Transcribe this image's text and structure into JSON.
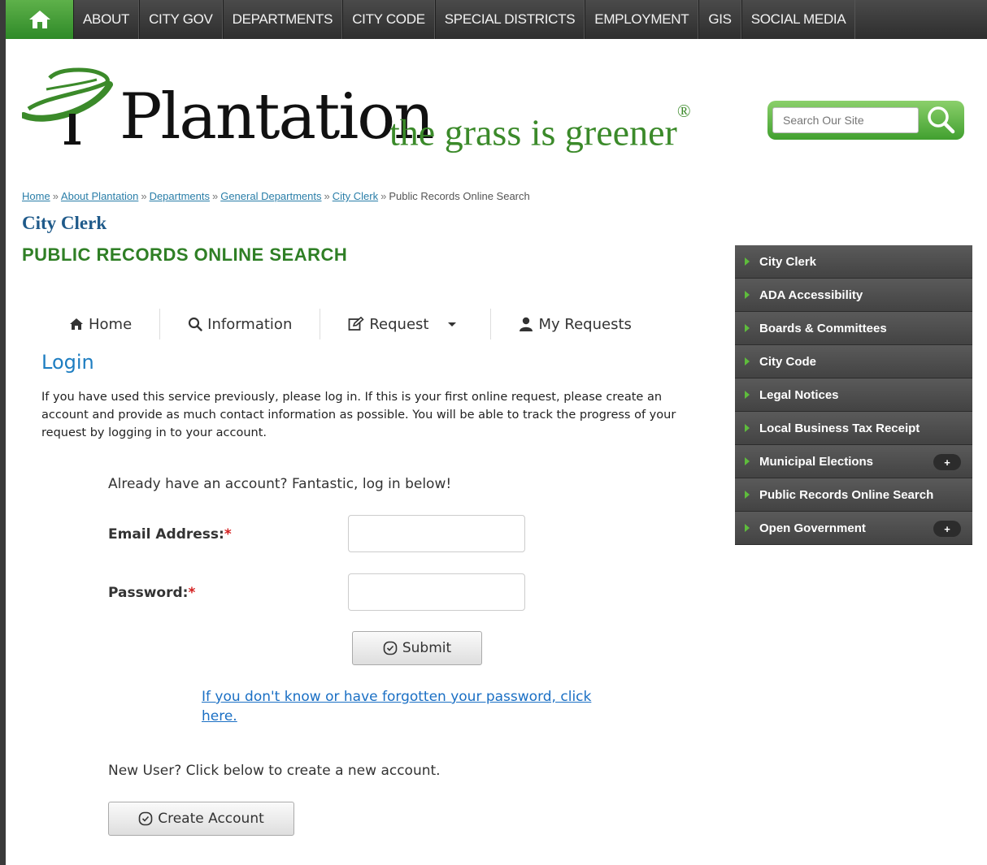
{
  "nav": {
    "items": [
      "ABOUT",
      "CITY GOV",
      "DEPARTMENTS",
      "CITY CODE",
      "SPECIAL DISTRICTS",
      "EMPLOYMENT",
      "GIS",
      "SOCIAL MEDIA"
    ]
  },
  "header": {
    "wordmark": "Plantation",
    "tagline": "the grass is greener",
    "tagline_mark": "®",
    "search_placeholder": "Search Our Site"
  },
  "breadcrumb": {
    "links": [
      "Home",
      "About Plantation",
      "Departments",
      "General Departments",
      "City Clerk"
    ],
    "current": "Public Records Online Search",
    "separator": "»"
  },
  "section_title": "City Clerk",
  "page_title": "PUBLIC RECORDS ONLINE SEARCH",
  "tabs": {
    "home": "Home",
    "information": "Information",
    "request": "Request",
    "my_requests": "My Requests"
  },
  "login": {
    "heading": "Login",
    "intro": "If you have used this service previously, please log in. If this is your first online request, please create an account and provide as much contact information as possible. You will be able to track the progress of your request by logging in to your account.",
    "already": "Already have an account? Fantastic, log in below!",
    "email_label": "Email Address:",
    "password_label": "Password:",
    "required_mark": "*",
    "submit": "Submit",
    "forgot": "If you don't know or have forgotten your password, click here.",
    "new_user": "New User? Click below to create a new account.",
    "create_account": "Create Account"
  },
  "sidebar": {
    "items": [
      {
        "label": "City Clerk",
        "expand": ""
      },
      {
        "label": "ADA Accessibility",
        "expand": ""
      },
      {
        "label": "Boards & Committees",
        "expand": ""
      },
      {
        "label": "City Code",
        "expand": ""
      },
      {
        "label": "Legal Notices",
        "expand": ""
      },
      {
        "label": "Local Business Tax Receipt",
        "expand": ""
      },
      {
        "label": "Municipal Elections",
        "expand": "+"
      },
      {
        "label": "Public Records Online Search",
        "expand": ""
      },
      {
        "label": "Open Government",
        "expand": "+"
      }
    ]
  },
  "colors": {
    "brand_green": "#3b8a2a",
    "title_green": "#2f7f25",
    "link_blue": "#1a6fc4",
    "sidebar_bg": "#444444"
  }
}
